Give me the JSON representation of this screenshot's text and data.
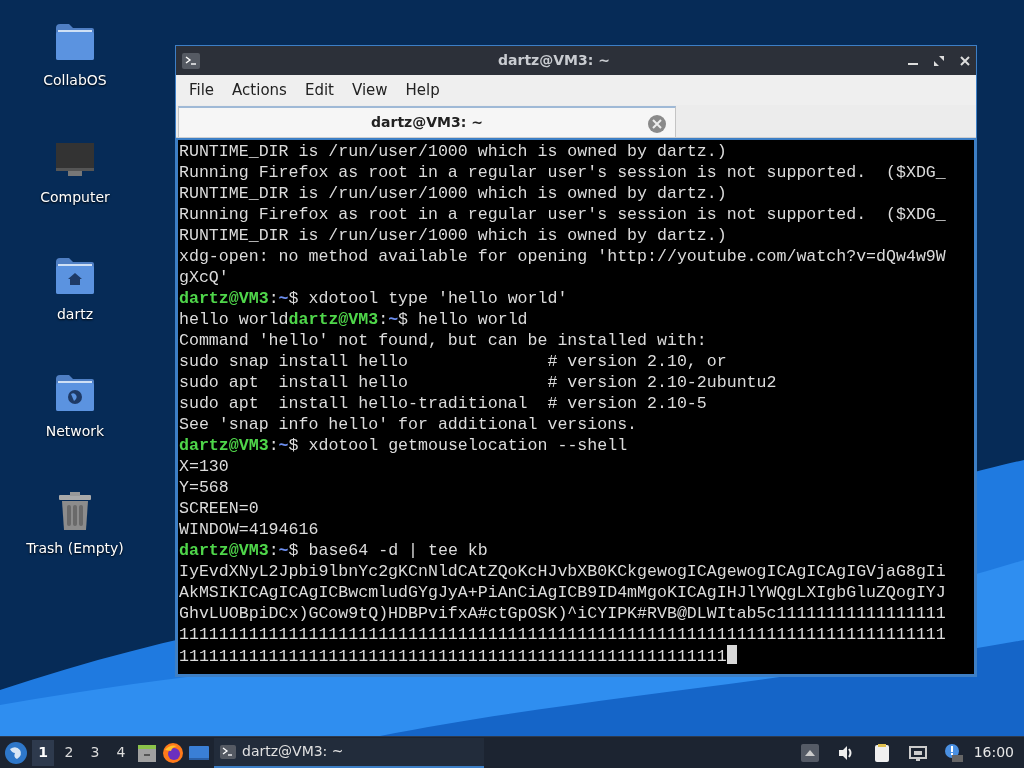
{
  "desktop_icons": [
    {
      "kind": "folder",
      "label": "CollabOS"
    },
    {
      "kind": "computer",
      "label": "Computer"
    },
    {
      "kind": "home",
      "label": "dartz"
    },
    {
      "kind": "network",
      "label": "Network"
    },
    {
      "kind": "trash",
      "label": "Trash (Empty)"
    }
  ],
  "window": {
    "title": "dartz@VM3: ~",
    "menu": [
      "File",
      "Actions",
      "Edit",
      "View",
      "Help"
    ],
    "tabs": [
      {
        "label": "dartz@VM3: ~",
        "selected": true
      }
    ],
    "terminal": {
      "cursor": true,
      "lines": [
        {
          "kind": "output",
          "text": "RUNTIME_DIR is /run/user/1000 which is owned by dartz.)"
        },
        {
          "kind": "output",
          "text": "Running Firefox as root in a regular user's session is not supported.  ($XDG_"
        },
        {
          "kind": "output",
          "text": "RUNTIME_DIR is /run/user/1000 which is owned by dartz.)"
        },
        {
          "kind": "output",
          "text": "Running Firefox as root in a regular user's session is not supported.  ($XDG_"
        },
        {
          "kind": "output",
          "text": "RUNTIME_DIR is /run/user/1000 which is owned by dartz.)"
        },
        {
          "kind": "output",
          "text": "xdg-open: no method available for opening 'http://youtube.com/watch?v=dQw4w9W"
        },
        {
          "kind": "output",
          "text": "gXcQ'"
        },
        {
          "kind": "prompt",
          "user": "dartz@VM3",
          "sep": ":",
          "path": "~",
          "command": "$ xdotool type 'hello world'"
        },
        {
          "kind": "prompt",
          "prefix": "hello world",
          "user": "dartz@VM3",
          "sep": ":",
          "path": "~",
          "command": "$ hello world"
        },
        {
          "kind": "output",
          "text": "Command 'hello' not found, but can be installed with:"
        },
        {
          "kind": "output",
          "text": "sudo snap install hello              # version 2.10, or"
        },
        {
          "kind": "output",
          "text": "sudo apt  install hello              # version 2.10-2ubuntu2"
        },
        {
          "kind": "output",
          "text": "sudo apt  install hello-traditional  # version 2.10-5"
        },
        {
          "kind": "output",
          "text": "See 'snap info hello' for additional versions."
        },
        {
          "kind": "prompt",
          "user": "dartz@VM3",
          "sep": ":",
          "path": "~",
          "command": "$ xdotool getmouselocation --shell"
        },
        {
          "kind": "output",
          "text": "X=130"
        },
        {
          "kind": "output",
          "text": "Y=568"
        },
        {
          "kind": "output",
          "text": "SCREEN=0"
        },
        {
          "kind": "output",
          "text": "WINDOW=4194616"
        },
        {
          "kind": "prompt",
          "user": "dartz@VM3",
          "sep": ":",
          "path": "~",
          "command": "$ base64 -d | tee kb"
        },
        {
          "kind": "output",
          "text": "IyEvdXNyL2Jpbi9lbnYc2gKCnNldCAtZQoKcHJvbXB0KCkgewogICAgewogICAgICAgIGVjaG8gIi"
        },
        {
          "kind": "output",
          "text": "AkMSIKICAgICAgICBwcmludGYgJyA+PiAnCiAgICB9ID4mMgoKICAgIHJlYWQgLXIgbGluZQogIYJ"
        },
        {
          "kind": "output",
          "text": "GhvLUOBpiDCx)GCow9tQ)HDBPvifxA#ctGpOSK)^iCYIPK#RVB@DLWItab5c11111111111111111"
        },
        {
          "kind": "output",
          "text": "11111111111111111111111111111111111111111111111111111111111111111111111111111"
        },
        {
          "kind": "output",
          "text": "1111111111111111111111111111111111111111111111111111111"
        }
      ]
    }
  },
  "taskbar": {
    "workspaces": [
      {
        "label": "1",
        "selected": true
      },
      {
        "label": "2",
        "selected": false
      },
      {
        "label": "3",
        "selected": false
      },
      {
        "label": "4",
        "selected": false
      }
    ],
    "launchers": [
      {
        "kind": "files"
      },
      {
        "kind": "firefox"
      },
      {
        "kind": "desktop"
      }
    ],
    "tasks": [
      {
        "label": "dartz@VM3: ~",
        "selected": true
      }
    ],
    "tray": [
      {
        "kind": "up"
      },
      {
        "kind": "volume"
      },
      {
        "kind": "clipboard"
      },
      {
        "kind": "network"
      },
      {
        "kind": "notification"
      }
    ],
    "clock": "16:00"
  }
}
